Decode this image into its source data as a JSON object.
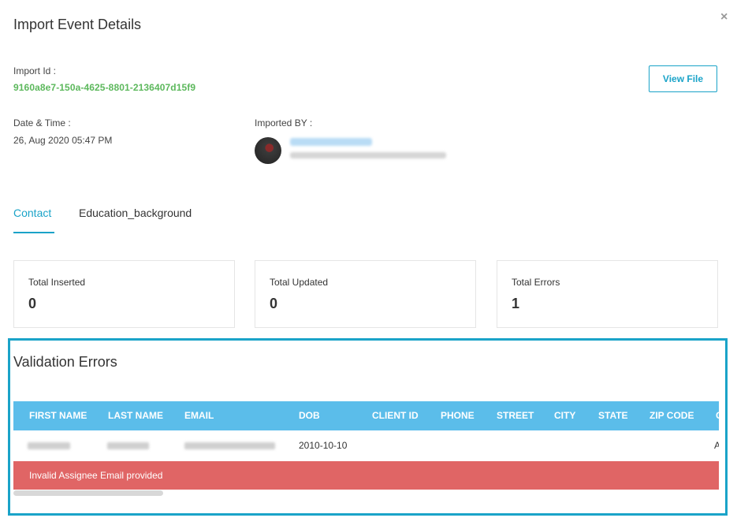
{
  "modal": {
    "title": "Import Event Details",
    "close_icon": "×"
  },
  "details": {
    "import_id_label": "Import Id :",
    "import_id_value": "9160a8e7-150a-4625-8801-2136407d15f9",
    "datetime_label": "Date & Time :",
    "datetime_value": "26, Aug 2020 05:47 PM",
    "imported_by_label": "Imported BY :"
  },
  "view_file_label": "View File",
  "tabs": [
    {
      "label": "Contact",
      "active": true
    },
    {
      "label": "Education_background",
      "active": false
    }
  ],
  "stats": [
    {
      "label": "Total Inserted",
      "value": "0"
    },
    {
      "label": "Total Updated",
      "value": "0"
    },
    {
      "label": "Total Errors",
      "value": "1"
    }
  ],
  "validation": {
    "title": "Validation Errors",
    "columns": [
      "FIRST NAME",
      "LAST NAME",
      "EMAIL",
      "DOB",
      "CLIENT ID",
      "PHONE",
      "STREET",
      "CITY",
      "STATE",
      "ZIP CODE",
      "C"
    ],
    "row": {
      "dob": "2010-10-10",
      "last_partial": "A"
    },
    "error_message": "Invalid Assignee Email provided"
  },
  "colors": {
    "accent": "#1aa3c8",
    "import_id": "#5cb85c",
    "table_header": "#5bbdea",
    "error_row": "#e06565"
  }
}
